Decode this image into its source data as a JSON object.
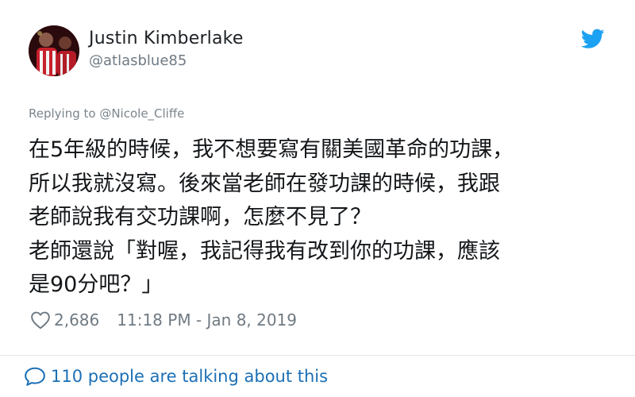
{
  "user": {
    "name": "Justin Kimberlake",
    "handle": "@atlasblue85"
  },
  "reply": {
    "text": "Replying to @Nicole_Cliffe"
  },
  "tweet": {
    "lines": [
      "在5年級的時候，我不想要寫有關美國革命的功課，",
      "所以我就沒寫。後來當老師在發功課的時候，我跟",
      "老師說我有交功課啊，怎麼不見了？",
      "老師還說「對喔，我記得我有改到你的功課，應該",
      "是90分吧？」"
    ]
  },
  "meta": {
    "likes": "2,686",
    "timestamp": "11:18 PM - Jan 8, 2019"
  },
  "footer": {
    "talking": "110 people are talking about this"
  },
  "colors": {
    "text": "#14171a",
    "secondary": "#6f7a83",
    "link": "#1b6fb5",
    "twitter_blue": "#1da1f2"
  },
  "icons": {
    "brand": "twitter-bird-icon",
    "like": "heart-icon",
    "conversation": "speech-bubble-icon"
  }
}
